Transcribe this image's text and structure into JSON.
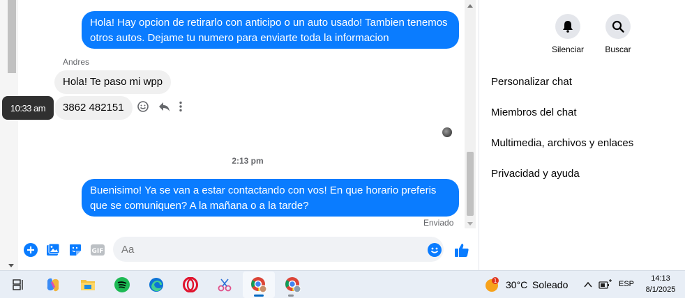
{
  "chat": {
    "messages": {
      "out_1": "Hola! Hay opcion de retirarlo con anticipo o un auto usado! Tambien tenemos otros autos. Dejame tu numero para enviarte toda la informacion",
      "sender_name": "Andres",
      "in_1": "Hola! Te paso mi wpp",
      "in_2": "3862 482151",
      "tooltip_time": "10:33 am",
      "time_divider": "2:13 pm",
      "out_2": "Buenisimo! Ya se van a estar contactando con vos! En que horario preferis que se comuniquen? A la mañana o a la tarde?",
      "status": "Enviado"
    },
    "composer": {
      "placeholder": "Aa"
    }
  },
  "panel": {
    "mute_label": "Silenciar",
    "search_label": "Buscar",
    "items": [
      "Personalizar chat",
      "Miembros del chat",
      "Multimedia, archivos y enlaces",
      "Privacidad y ayuda"
    ]
  },
  "taskbar": {
    "weather_badge": "1",
    "temperature": "30°C",
    "condition": "Soleado",
    "language": "ESP",
    "time": "14:13",
    "date": "8/1/2025"
  },
  "colors": {
    "accent": "#0a7cff",
    "incoming_bubble": "#f0f0f0"
  }
}
